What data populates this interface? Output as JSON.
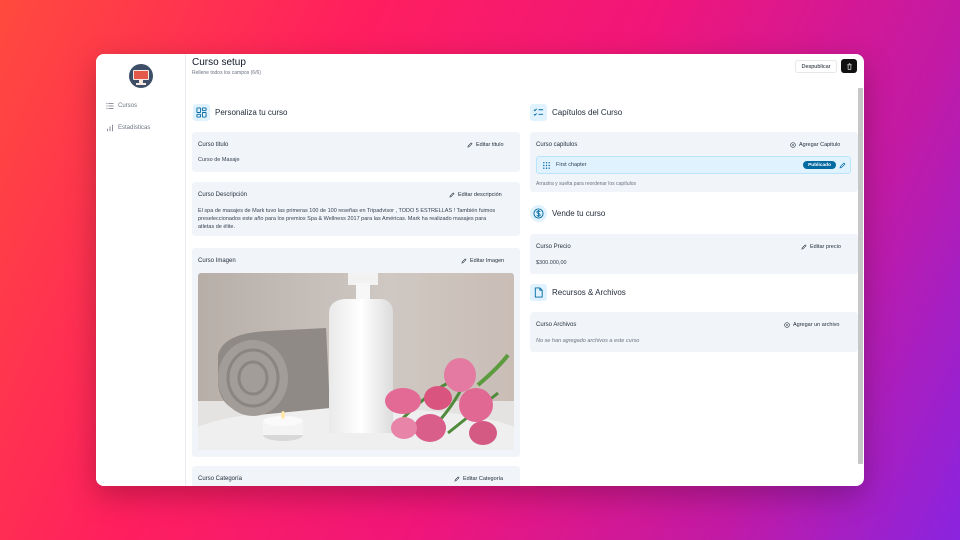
{
  "sidebar": {
    "items": [
      {
        "label": "Cursos",
        "icon": "list-icon"
      },
      {
        "label": "Estadísticas",
        "icon": "bar-chart-icon"
      }
    ]
  },
  "header": {
    "title": "Curso setup",
    "subtitle": "Rellene todos los campos (6/6)",
    "unpublish_label": "Despublicar",
    "delete_icon": "trash-icon"
  },
  "left": {
    "customize_title": "Personaliza tu curso",
    "title_card": {
      "label": "Curso titulo",
      "action": "Editar titulo",
      "value": "Curso de Masaje"
    },
    "description_card": {
      "label": "Curso Descripción",
      "action": "Editar descripción",
      "line1": "El spa de masajes de Mark tuvo las primeras 100 de 100 reseñas en Tripadvisor , TODO 5 ESTRELLAS ! También fuimos",
      "line2": "preseleccionados este año para los premios Spa & Wellness 2017 para las Américas. Mark ha realizado masajes para",
      "line3": "atletas de élite."
    },
    "image_card": {
      "label": "Curso Imagen",
      "action": "Editar Imagen"
    },
    "category_card": {
      "label": "Curso Categoría",
      "action": "Editar Categoría"
    }
  },
  "right": {
    "chapters_title": "Capítulos del Curso",
    "chapters_card": {
      "label": "Curso capitulos",
      "action": "Agregar Capitulo",
      "chapter_title": "First chapter",
      "chapter_badge": "Publicado",
      "hint": "Arrastra y suelta para reordenar los capítulos"
    },
    "sell_title": "Vende tu curso",
    "price_card": {
      "label": "Curso Precio",
      "action": "Editar precio",
      "value": "$300.000,00"
    },
    "resources_title": "Recursos & Archivos",
    "files_card": {
      "label": "Curso Archivos",
      "action": "Agregar un archivo",
      "empty": "No se han agregado archivos a este curso"
    }
  },
  "colors": {
    "accent": "#0369a1",
    "icon_bg": "#e0f2fe",
    "card_bg": "#f1f5f9"
  }
}
